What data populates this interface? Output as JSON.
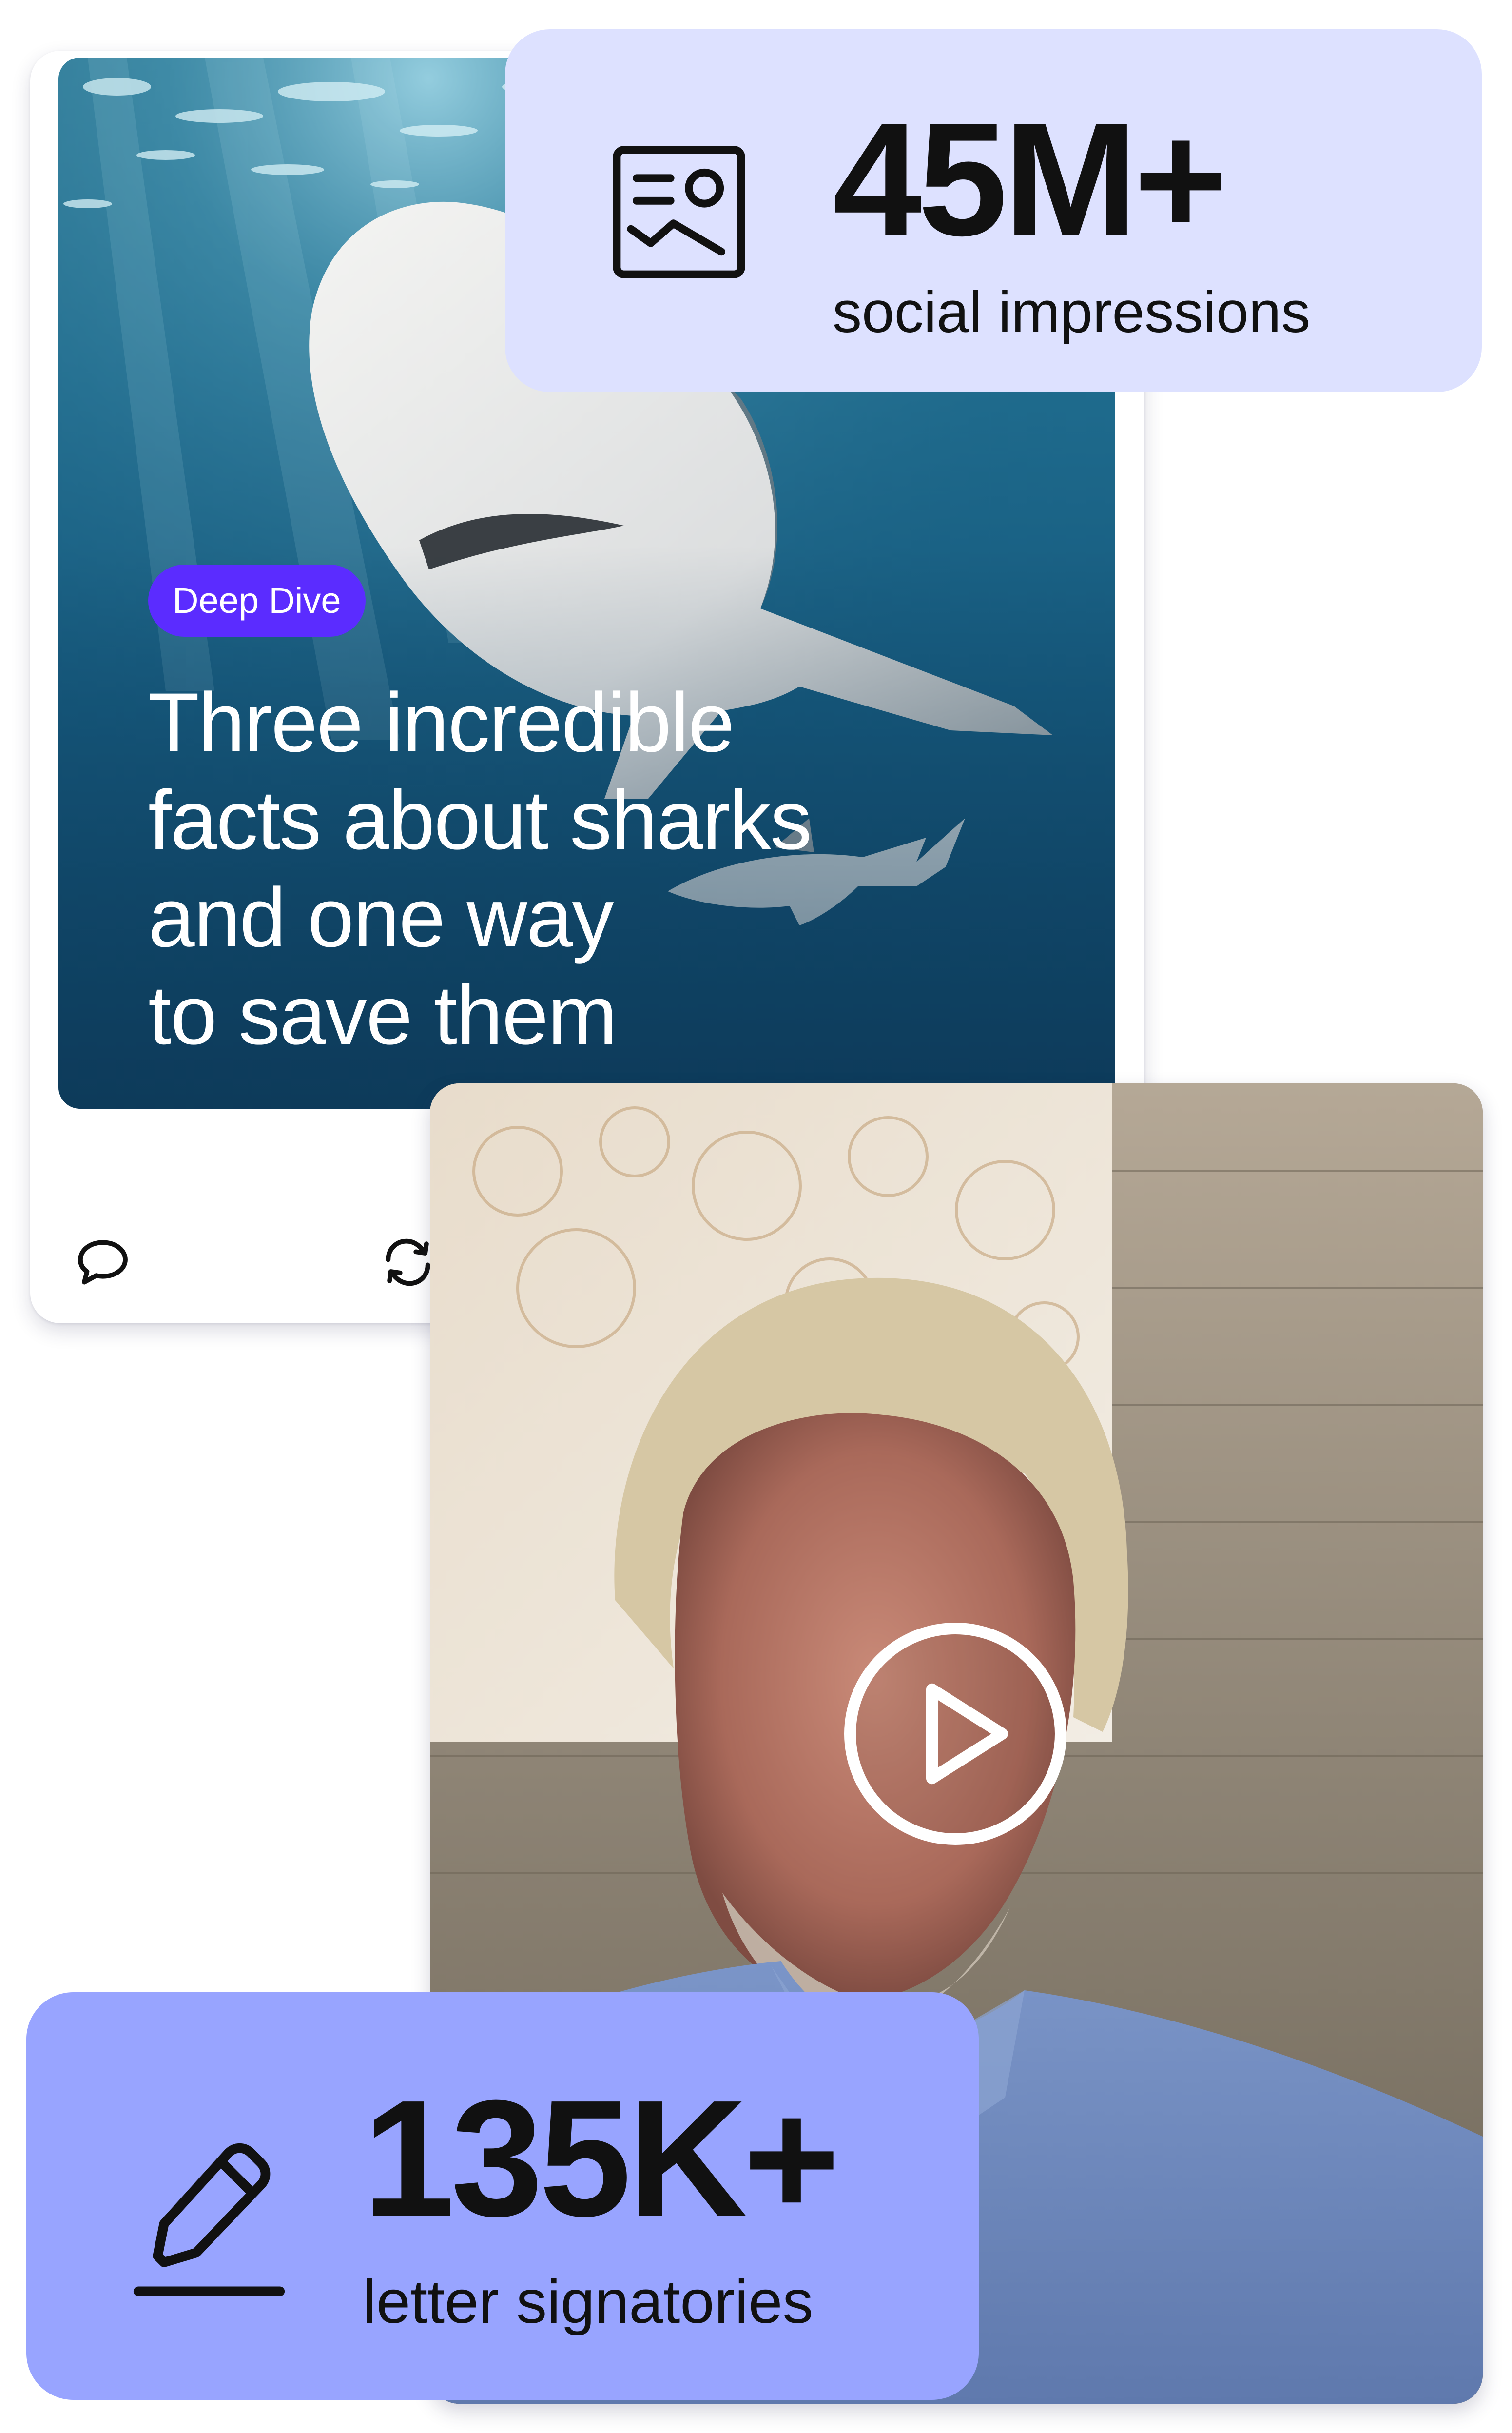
{
  "post": {
    "tag": "Deep Dive",
    "headline_lines": [
      "Three incredible",
      "facts about sharks",
      "and one way",
      "to save them"
    ],
    "actions": [
      {
        "icon": "comment-icon"
      },
      {
        "icon": "repost-icon"
      }
    ],
    "tag_color": "#5b2cff"
  },
  "stats": [
    {
      "value": "45M+",
      "label": "social impressions",
      "icon": "image-post-icon",
      "background": "#dde1ff"
    },
    {
      "value": "135K+",
      "label": "letter signatories",
      "icon": "pencil-sign-icon",
      "background": "#98a4ff"
    }
  ],
  "video": {
    "control_icon": "play-icon"
  }
}
